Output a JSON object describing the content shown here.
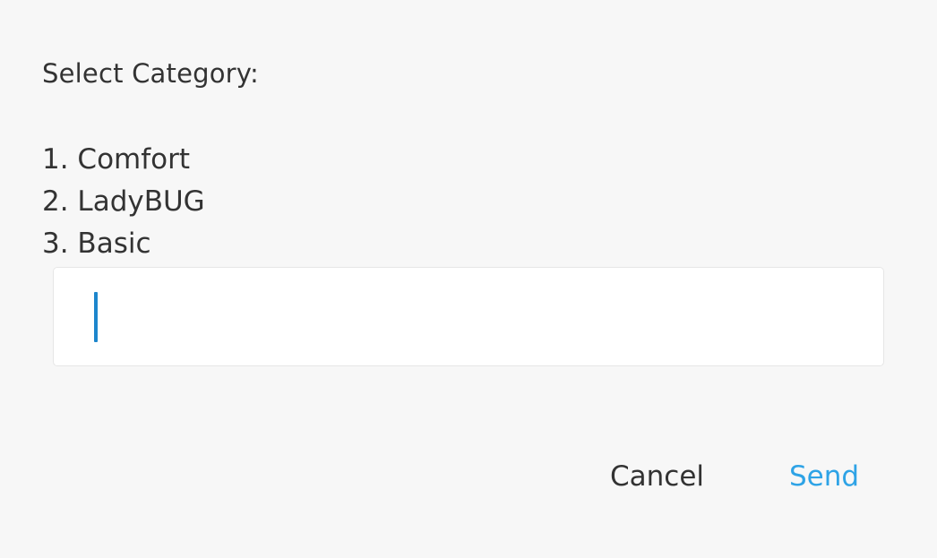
{
  "dialog": {
    "title": "Select Category:",
    "options": [
      {
        "label": "1. Comfort"
      },
      {
        "label": "2. LadyBUG"
      },
      {
        "label": "3. Basic"
      }
    ],
    "input": {
      "value": "",
      "placeholder": ""
    },
    "buttons": {
      "cancel_label": "Cancel",
      "send_label": "Send"
    },
    "colors": {
      "background": "#f7f7f7",
      "text": "#333333",
      "accent": "#2ea3e6",
      "caret": "#1d86cc",
      "input_background": "#ffffff"
    }
  }
}
